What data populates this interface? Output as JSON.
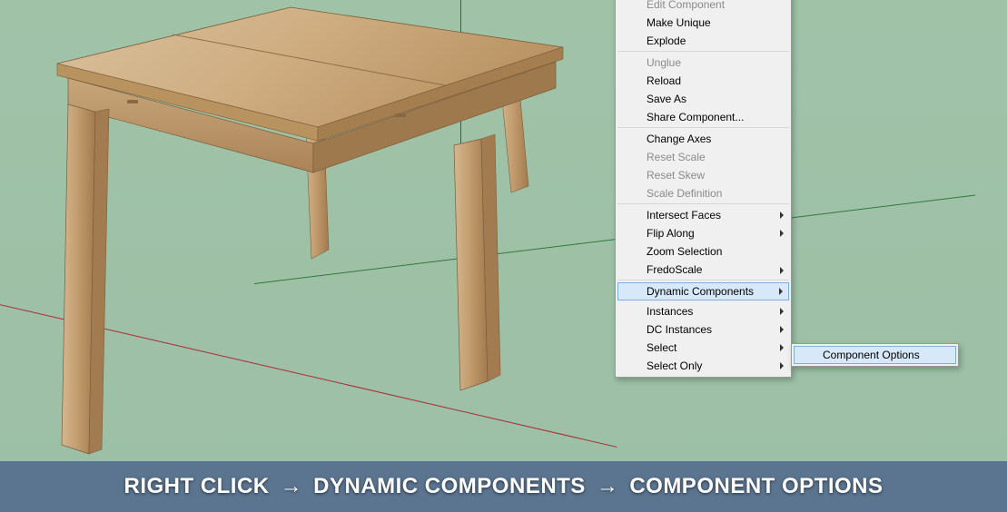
{
  "context_menu": {
    "items": [
      {
        "label": "Edit Component",
        "disabled": true,
        "submenu": false,
        "sep": false
      },
      {
        "label": "Make Unique",
        "disabled": false,
        "submenu": false,
        "sep": false
      },
      {
        "label": "Explode",
        "disabled": false,
        "submenu": false,
        "sep": true
      },
      {
        "label": "Unglue",
        "disabled": true,
        "submenu": false,
        "sep": false
      },
      {
        "label": "Reload",
        "disabled": false,
        "submenu": false,
        "sep": false
      },
      {
        "label": "Save As",
        "disabled": false,
        "submenu": false,
        "sep": false
      },
      {
        "label": "Share Component...",
        "disabled": false,
        "submenu": false,
        "sep": true
      },
      {
        "label": "Change Axes",
        "disabled": false,
        "submenu": false,
        "sep": false
      },
      {
        "label": "Reset Scale",
        "disabled": true,
        "submenu": false,
        "sep": false
      },
      {
        "label": "Reset Skew",
        "disabled": true,
        "submenu": false,
        "sep": false
      },
      {
        "label": "Scale Definition",
        "disabled": true,
        "submenu": false,
        "sep": true
      },
      {
        "label": "Intersect Faces",
        "disabled": false,
        "submenu": true,
        "sep": false
      },
      {
        "label": "Flip Along",
        "disabled": false,
        "submenu": true,
        "sep": false
      },
      {
        "label": "Zoom Selection",
        "disabled": false,
        "submenu": false,
        "sep": false
      },
      {
        "label": "FredoScale",
        "disabled": false,
        "submenu": true,
        "sep": true
      },
      {
        "label": "Dynamic Components",
        "disabled": false,
        "submenu": true,
        "sep": true,
        "highlight": true
      },
      {
        "label": "Instances",
        "disabled": false,
        "submenu": true,
        "sep": false
      },
      {
        "label": "DC Instances",
        "disabled": false,
        "submenu": true,
        "sep": false
      },
      {
        "label": "Select",
        "disabled": false,
        "submenu": true,
        "sep": false
      },
      {
        "label": "Select Only",
        "disabled": false,
        "submenu": true,
        "sep": false
      }
    ]
  },
  "submenu": {
    "items": [
      {
        "label": "Component Options",
        "highlight": true
      }
    ]
  },
  "banner": {
    "part1": "RIGHT CLICK",
    "arrow": "→",
    "part2": "DYNAMIC COMPONENTS",
    "part3": "COMPONENT OPTIONS"
  },
  "colors": {
    "wood_light": "#dcc4a2",
    "wood_mid": "#c8a97d",
    "wood_dark": "#a58057",
    "bg": "#9cbfa5",
    "banner_bg": "#5b7590"
  }
}
